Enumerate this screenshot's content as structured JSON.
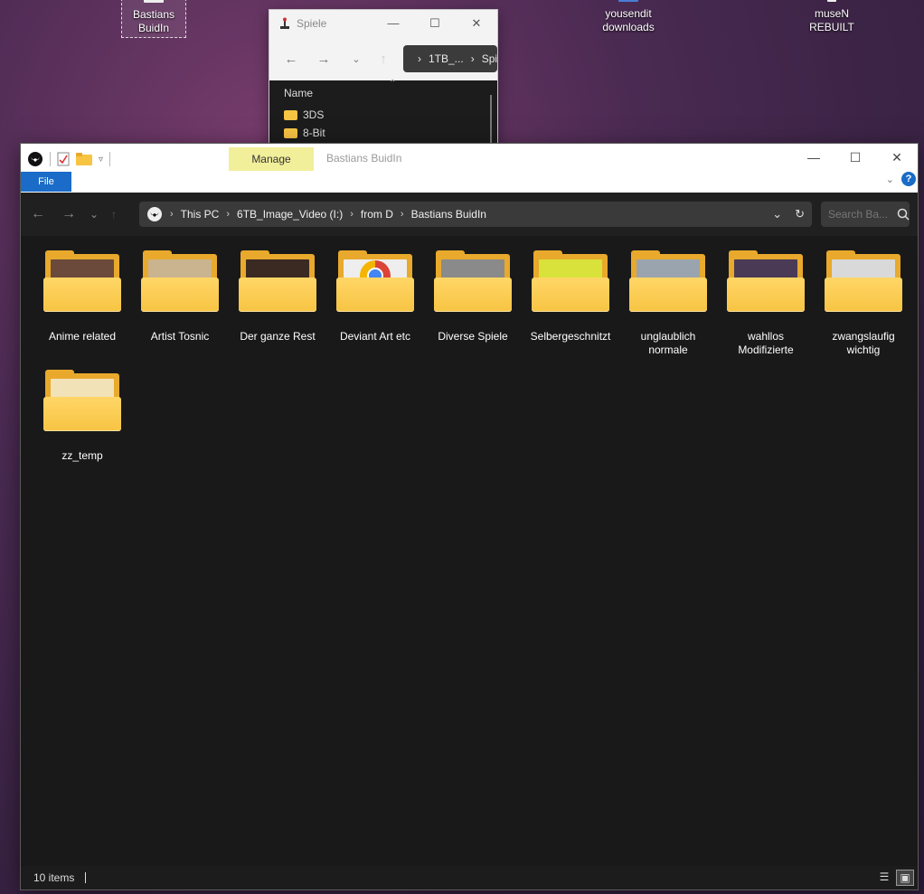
{
  "desktop": {
    "icons": [
      {
        "label": "Bastians\nBuidIn"
      },
      {
        "label": "yousendit\ndownloads"
      },
      {
        "label": "museN\nREBUILT"
      }
    ]
  },
  "back_window": {
    "title": "Spiele",
    "address": [
      "1TB_...",
      "Spie"
    ],
    "column_header": "Name",
    "rows": [
      "3DS",
      "8-Bit"
    ],
    "controls": {
      "minimize": "—",
      "maximize": "☐",
      "close": "✕"
    }
  },
  "explorer": {
    "title": "Bastians BuidIn",
    "manage_tab": "Manage",
    "file_tab": "File",
    "help": "?",
    "controls": {
      "minimize": "—",
      "maximize": "☐",
      "close": "✕"
    },
    "nav": {
      "back": "←",
      "forward": "→",
      "recent": "⌄",
      "up": "↑"
    },
    "breadcrumb": [
      "This PC",
      "6TB_Image_Video (I:)",
      "from D",
      "Bastians BuidIn"
    ],
    "search_placeholder": "Search Ba...",
    "folders": [
      {
        "name": "Anime related",
        "thumb": "#6b4a3c"
      },
      {
        "name": "Artist Tosnic",
        "thumb": "#c9b48f"
      },
      {
        "name": "Der ganze Rest",
        "thumb": "#3a2a22"
      },
      {
        "name": "Deviant Art etc",
        "thumb": "chrome"
      },
      {
        "name": "Diverse Spiele",
        "thumb": "#8a8a8a"
      },
      {
        "name": "Selbergeschnitzt",
        "thumb": "#d8e23a"
      },
      {
        "name": "unglaublich normale",
        "thumb": "#9aa4ae"
      },
      {
        "name": "wahllos Modifizierte",
        "thumb": "#4a3a55"
      },
      {
        "name": "zwangslaufig wichtig",
        "thumb": "#d9d9d9"
      },
      {
        "name": "zz_temp",
        "thumb": "#f2e2b8"
      }
    ],
    "status": {
      "count": "10 items"
    }
  }
}
